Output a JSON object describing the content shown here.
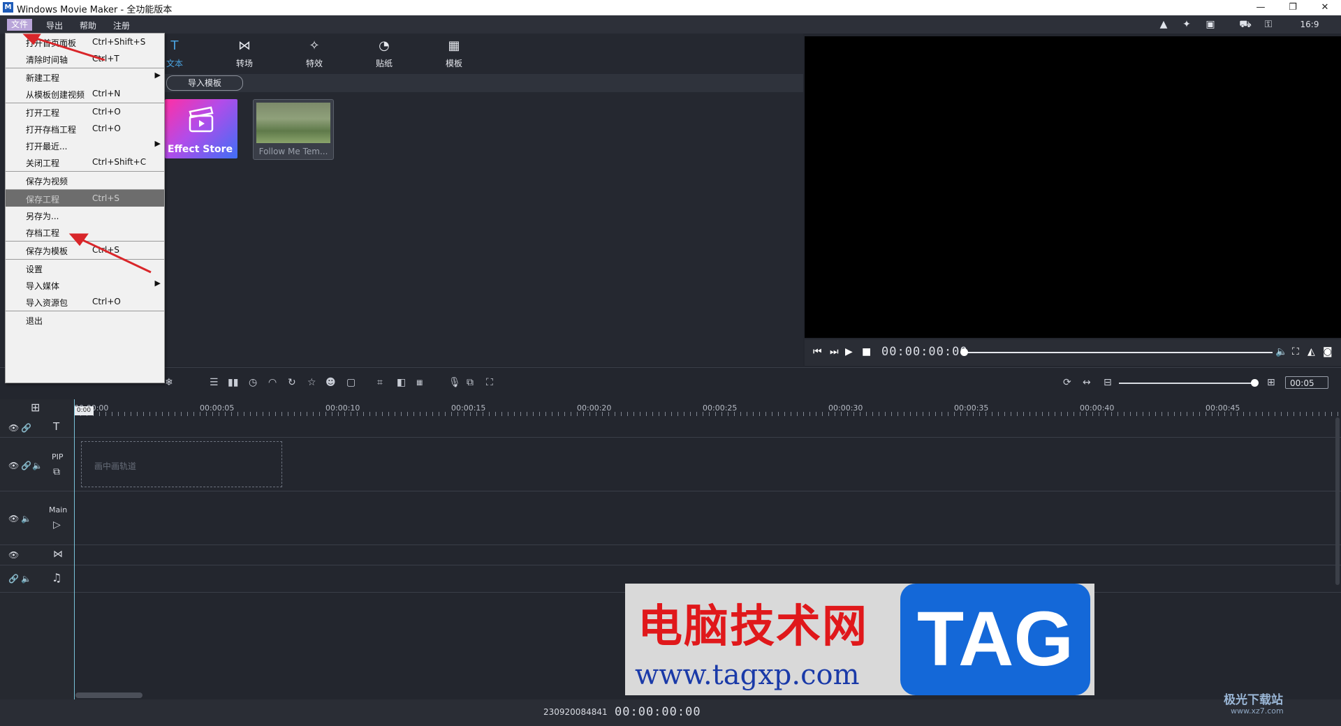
{
  "window": {
    "title": "Windows Movie Maker - 全功能版本",
    "logo": "M",
    "minimize": "—",
    "maximize": "❐",
    "close": "✕"
  },
  "menubar": {
    "items": [
      "文件",
      "导出",
      "帮助",
      "注册"
    ]
  },
  "toolbar_icons": [
    "share-icon",
    "star-icon",
    "save-icon",
    "cart-icon",
    "key-icon",
    "ratio-icon"
  ],
  "content_tabs": [
    {
      "label": "文本",
      "icon": "T"
    },
    {
      "label": "转场",
      "icon": "⋈"
    },
    {
      "label": "特效",
      "icon": "✧"
    },
    {
      "label": "贴纸",
      "icon": "◔"
    },
    {
      "label": "模板",
      "icon": "▦"
    }
  ],
  "subbar": {
    "import_template": "导入模板"
  },
  "templates": [
    {
      "label": "Effect Store"
    },
    {
      "label": "Follow Me Tem..."
    }
  ],
  "file_menu": [
    {
      "label": "打开首页面板",
      "shortcut": "Ctrl+Shift+S"
    },
    {
      "label": "清除时间轴",
      "shortcut": "Ctrl+T"
    },
    {
      "label": "新建工程",
      "shortcut": "",
      "submenu": true
    },
    {
      "label": "从模板创建视频",
      "shortcut": "Ctrl+N"
    },
    {
      "label": "打开工程",
      "shortcut": "Ctrl+O"
    },
    {
      "label": "打开存档工程",
      "shortcut": "Ctrl+O"
    },
    {
      "label": "打开最近...",
      "shortcut": "",
      "submenu": true
    },
    {
      "label": "关闭工程",
      "shortcut": "Ctrl+Shift+C"
    },
    {
      "label": "保存为视频",
      "shortcut": ""
    },
    {
      "label": "保存工程",
      "shortcut": "Ctrl+S",
      "highlighted": true
    },
    {
      "label": "另存为...",
      "shortcut": ""
    },
    {
      "label": "存档工程",
      "shortcut": ""
    },
    {
      "label": "保存为模板",
      "shortcut": "Ctrl+S"
    },
    {
      "label": "设置",
      "shortcut": ""
    },
    {
      "label": "导入媒体",
      "shortcut": "",
      "submenu": true
    },
    {
      "label": "导入资源包",
      "shortcut": "Ctrl+O"
    },
    {
      "label": "退出",
      "shortcut": ""
    }
  ],
  "preview": {
    "timecode": "00:00:00:00"
  },
  "timeline": {
    "zoom_value": "00:05",
    "ruler_ticks": [
      "00:00:00",
      "00:00:05",
      "00:00:10",
      "00:00:15",
      "00:00:20",
      "00:00:25",
      "00:00:30",
      "00:00:35",
      "00:00:40",
      "00:00:45"
    ],
    "playhead_label": "0:00",
    "tracks": {
      "pip_label": "PIP",
      "main_label": "Main",
      "pip_placeholder": "画中画轨道"
    }
  },
  "status": {
    "serial": "230920084841",
    "timecode": "00:00:00:00"
  },
  "watermark": {
    "cn": "电脑技术网",
    "url": "www.tagxp.com",
    "tag": "TAG",
    "site2": "极光下载站",
    "site2_url": "www.xz7.com"
  }
}
